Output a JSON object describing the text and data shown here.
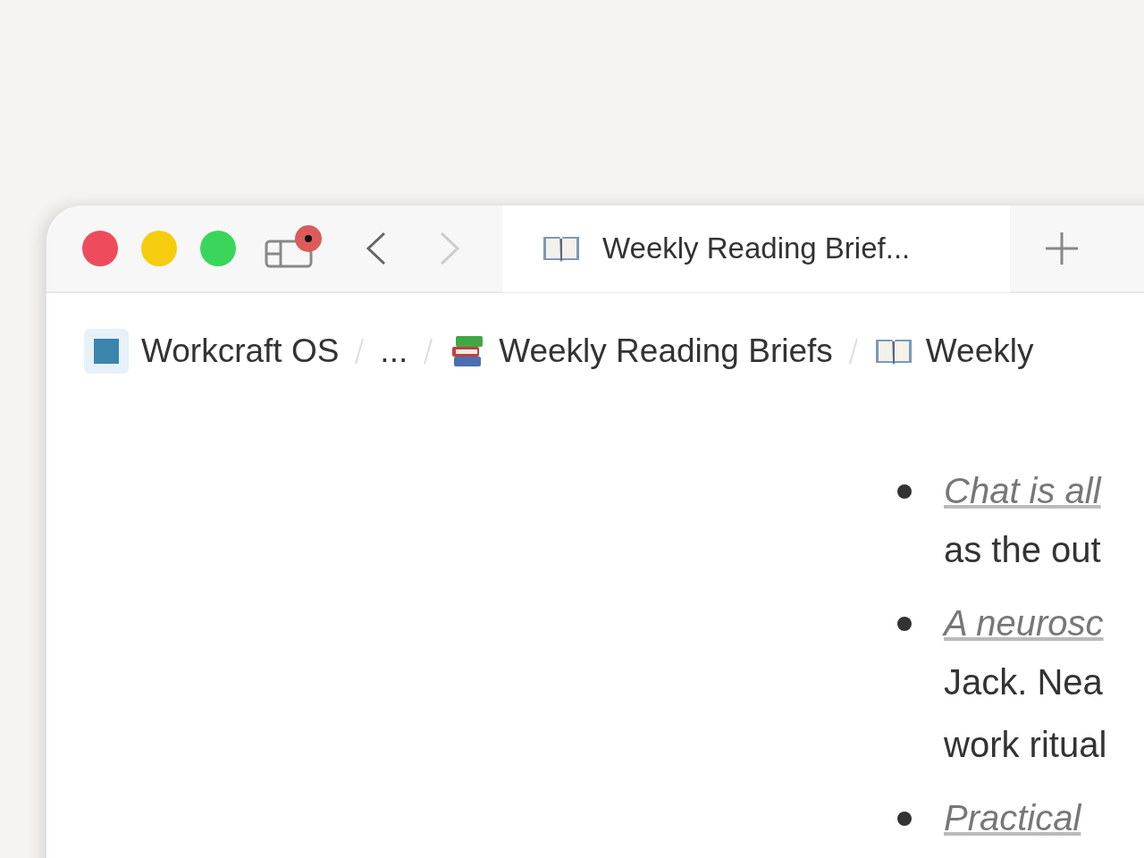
{
  "window": {
    "controls": [
      {
        "kind": "close"
      },
      {
        "kind": "minimize"
      },
      {
        "kind": "zoom"
      }
    ]
  },
  "toolbar": {
    "sidebar_badge": true,
    "back_disabled": false,
    "forward_disabled": true
  },
  "tab": {
    "title": "Weekly Reading Brief...",
    "selected": true
  },
  "breadcrumbs": [
    {
      "kind": "workspace",
      "label": "Workcraft OS"
    },
    {
      "kind": "ellipsis",
      "label": "..."
    },
    {
      "kind": "books",
      "label": "Weekly Reading Briefs"
    },
    {
      "kind": "book",
      "label": "Weekly"
    }
  ],
  "bullets": [
    {
      "link": "Chat is all",
      "lines": [
        "as the out"
      ]
    },
    {
      "link": "A neurosc",
      "lines": [
        "Jack. Nea",
        "work ritual"
      ]
    },
    {
      "link": "Practical"
    }
  ]
}
